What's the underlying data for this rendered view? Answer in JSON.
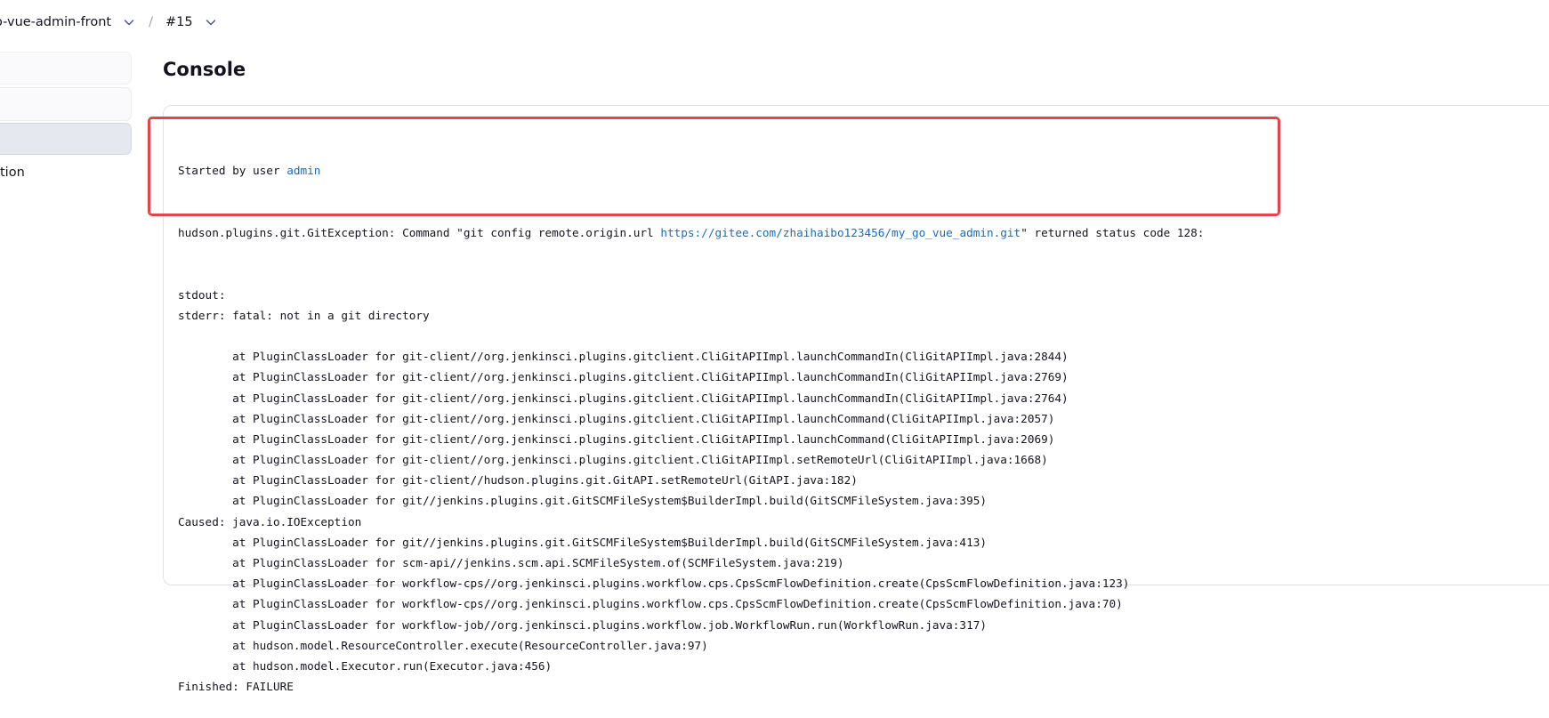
{
  "breadcrumb": {
    "job_name": "o-vue-admin-front",
    "separator": "/",
    "build_number": "#15"
  },
  "sidebar": {
    "partial_label": "tion"
  },
  "page": {
    "title": "Console"
  },
  "console": {
    "started_prefix": "Started by user ",
    "started_user": "admin",
    "line2_prefix": "hudson.plugins.git.GitException: Command \"git config remote.origin.url ",
    "line2_url": "https://gitee.com/zhaihaibo123456/my_go_vue_admin.git",
    "line2_suffix": "\" returned status code 128:",
    "lines_after_error": [
      "stdout: ",
      "stderr: fatal: not in a git directory",
      "",
      "\tat PluginClassLoader for git-client//org.jenkinsci.plugins.gitclient.CliGitAPIImpl.launchCommandIn(CliGitAPIImpl.java:2844)",
      "\tat PluginClassLoader for git-client//org.jenkinsci.plugins.gitclient.CliGitAPIImpl.launchCommandIn(CliGitAPIImpl.java:2769)",
      "\tat PluginClassLoader for git-client//org.jenkinsci.plugins.gitclient.CliGitAPIImpl.launchCommandIn(CliGitAPIImpl.java:2764)",
      "\tat PluginClassLoader for git-client//org.jenkinsci.plugins.gitclient.CliGitAPIImpl.launchCommand(CliGitAPIImpl.java:2057)",
      "\tat PluginClassLoader for git-client//org.jenkinsci.plugins.gitclient.CliGitAPIImpl.launchCommand(CliGitAPIImpl.java:2069)",
      "\tat PluginClassLoader for git-client//org.jenkinsci.plugins.gitclient.CliGitAPIImpl.setRemoteUrl(CliGitAPIImpl.java:1668)",
      "\tat PluginClassLoader for git-client//hudson.plugins.git.GitAPI.setRemoteUrl(GitAPI.java:182)",
      "\tat PluginClassLoader for git//jenkins.plugins.git.GitSCMFileSystem$BuilderImpl.build(GitSCMFileSystem.java:395)",
      "Caused: java.io.IOException",
      "\tat PluginClassLoader for git//jenkins.plugins.git.GitSCMFileSystem$BuilderImpl.build(GitSCMFileSystem.java:413)",
      "\tat PluginClassLoader for scm-api//jenkins.scm.api.SCMFileSystem.of(SCMFileSystem.java:219)",
      "\tat PluginClassLoader for workflow-cps//org.jenkinsci.plugins.workflow.cps.CpsScmFlowDefinition.create(CpsScmFlowDefinition.java:123)",
      "\tat PluginClassLoader for workflow-cps//org.jenkinsci.plugins.workflow.cps.CpsScmFlowDefinition.create(CpsScmFlowDefinition.java:70)",
      "\tat PluginClassLoader for workflow-job//org.jenkinsci.plugins.workflow.job.WorkflowRun.run(WorkflowRun.java:317)",
      "\tat hudson.model.ResourceController.execute(ResourceController.java:97)",
      "\tat hudson.model.Executor.run(Executor.java:456)",
      "Finished: FAILURE"
    ]
  },
  "colors": {
    "link": "#1c6bbf",
    "highlight_border": "#e2454b",
    "sidebar_active": "#e6e8f0"
  },
  "icons": {
    "breadcrumb_chevron": "chevron-down-icon"
  }
}
